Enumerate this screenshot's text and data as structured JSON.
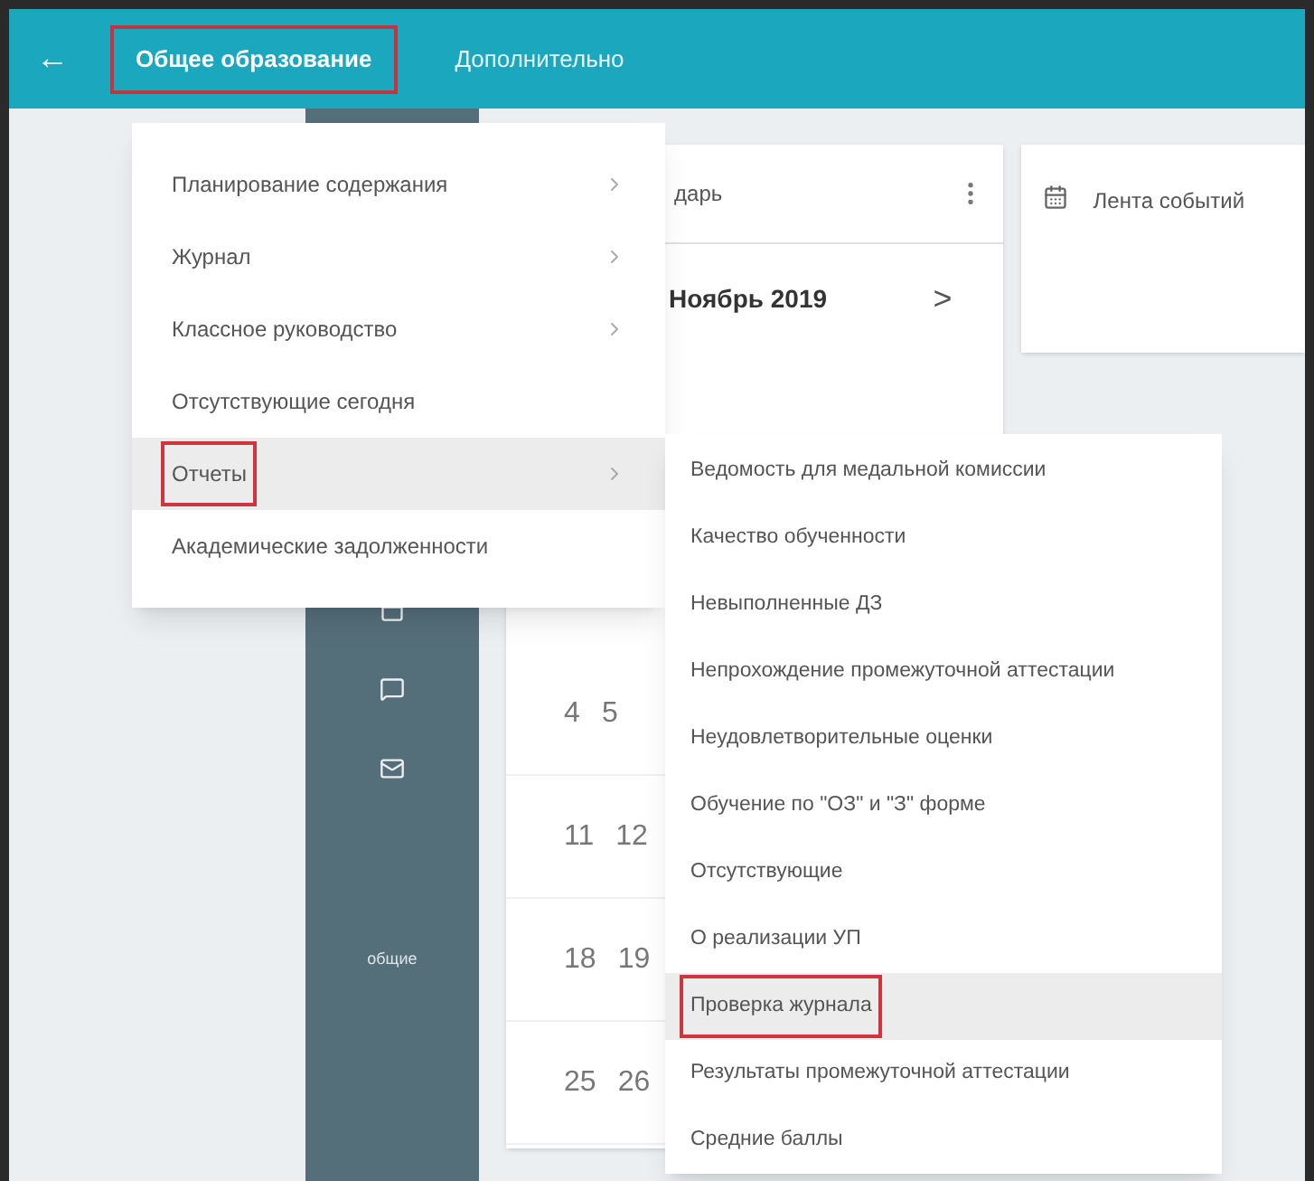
{
  "top_bar": {
    "back": "←",
    "tabs": [
      {
        "label": "Общее образование",
        "selected": true,
        "highlighted": true
      },
      {
        "label": "Дополнительно",
        "selected": false,
        "highlighted": false
      }
    ]
  },
  "sidebar": {
    "label": "общие"
  },
  "calendar_card": {
    "title": "дарь",
    "month": "Ноябрь 2019",
    "next": ">",
    "weeks": [
      [
        "4",
        "5"
      ],
      [
        "11",
        "12"
      ],
      [
        "18",
        "19"
      ],
      [
        "25",
        "26"
      ]
    ]
  },
  "events_card": {
    "title": "Лента событий"
  },
  "menu": [
    {
      "label": "Планирование содержания",
      "has_submenu": true,
      "selected": false,
      "highlighted": false
    },
    {
      "label": "Журнал",
      "has_submenu": true,
      "selected": false,
      "highlighted": false
    },
    {
      "label": "Классное руководство",
      "has_submenu": true,
      "selected": false,
      "highlighted": false
    },
    {
      "label": "Отсутствующие сегодня",
      "has_submenu": false,
      "selected": false,
      "highlighted": false
    },
    {
      "label": "Отчеты",
      "has_submenu": true,
      "selected": true,
      "highlighted": true
    },
    {
      "label": "Академические задолженности",
      "has_submenu": false,
      "selected": false,
      "highlighted": false
    }
  ],
  "submenu": [
    {
      "label": "Ведомость для медальной комиссии",
      "selected": false,
      "highlighted": false
    },
    {
      "label": "Качество обученности",
      "selected": false,
      "highlighted": false
    },
    {
      "label": "Невыполненные ДЗ",
      "selected": false,
      "highlighted": false
    },
    {
      "label": "Непрохождение промежуточной аттестации",
      "selected": false,
      "highlighted": false
    },
    {
      "label": "Неудовлетворительные оценки",
      "selected": false,
      "highlighted": false
    },
    {
      "label": "Обучение по \"ОЗ\" и \"З\" форме",
      "selected": false,
      "highlighted": false
    },
    {
      "label": "Отсутствующие",
      "selected": false,
      "highlighted": false
    },
    {
      "label": "О реализации УП",
      "selected": false,
      "highlighted": false
    },
    {
      "label": "Проверка журнала",
      "selected": true,
      "highlighted": true
    },
    {
      "label": "Результаты промежуточной аттестации",
      "selected": false,
      "highlighted": false
    },
    {
      "label": "Средние баллы",
      "selected": false,
      "highlighted": false
    }
  ]
}
